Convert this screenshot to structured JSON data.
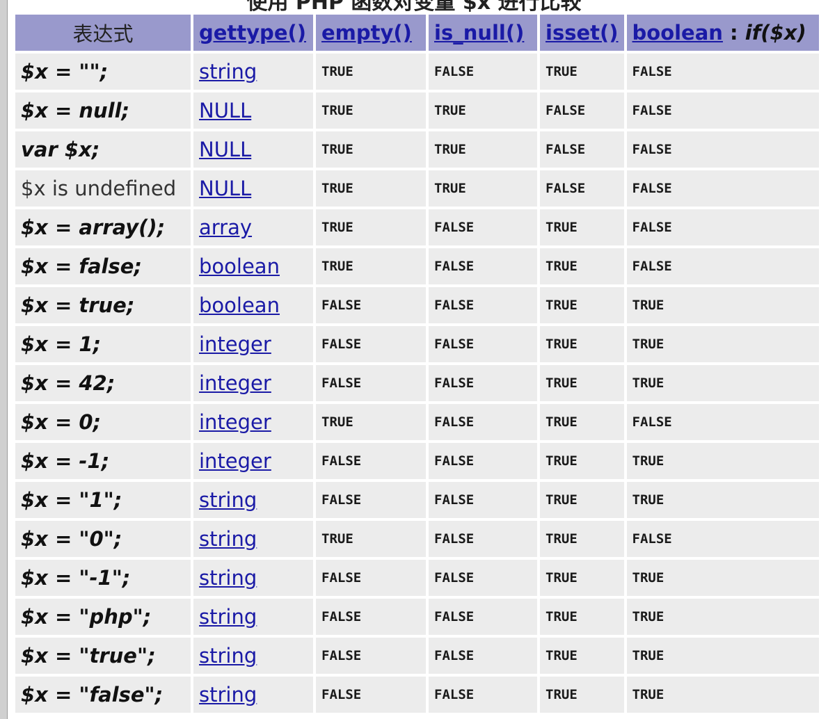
{
  "caption": "使用 PHP 函数对变量 $x 进行比较",
  "headers": {
    "expression": "表达式",
    "gettype": "gettype()",
    "empty": "empty()",
    "is_null": "is_null()",
    "isset": "isset()",
    "boolean": "boolean",
    "boolean_sep": " : ",
    "boolean_if": "if($x)"
  },
  "rows": [
    {
      "expr": "$x = \"\";",
      "type": "string",
      "empty": "TRUE",
      "is_null": "FALSE",
      "isset": "TRUE",
      "boolean": "FALSE"
    },
    {
      "expr": "$x = null;",
      "type": "NULL",
      "empty": "TRUE",
      "is_null": "TRUE",
      "isset": "FALSE",
      "boolean": "FALSE"
    },
    {
      "expr": "var $x;",
      "type": "NULL",
      "empty": "TRUE",
      "is_null": "TRUE",
      "isset": "FALSE",
      "boolean": "FALSE"
    },
    {
      "expr": "$x is undefined",
      "type": "NULL",
      "empty": "TRUE",
      "is_null": "TRUE",
      "isset": "FALSE",
      "boolean": "FALSE"
    },
    {
      "expr": "$x = array();",
      "type": "array",
      "empty": "TRUE",
      "is_null": "FALSE",
      "isset": "TRUE",
      "boolean": "FALSE"
    },
    {
      "expr": "$x = false;",
      "type": "boolean",
      "empty": "TRUE",
      "is_null": "FALSE",
      "isset": "TRUE",
      "boolean": "FALSE"
    },
    {
      "expr": "$x = true;",
      "type": "boolean",
      "empty": "FALSE",
      "is_null": "FALSE",
      "isset": "TRUE",
      "boolean": "TRUE"
    },
    {
      "expr": "$x = 1;",
      "type": "integer",
      "empty": "FALSE",
      "is_null": "FALSE",
      "isset": "TRUE",
      "boolean": "TRUE"
    },
    {
      "expr": "$x = 42;",
      "type": "integer",
      "empty": "FALSE",
      "is_null": "FALSE",
      "isset": "TRUE",
      "boolean": "TRUE"
    },
    {
      "expr": "$x = 0;",
      "type": "integer",
      "empty": "TRUE",
      "is_null": "FALSE",
      "isset": "TRUE",
      "boolean": "FALSE"
    },
    {
      "expr": "$x = -1;",
      "type": "integer",
      "empty": "FALSE",
      "is_null": "FALSE",
      "isset": "TRUE",
      "boolean": "TRUE"
    },
    {
      "expr": "$x = \"1\";",
      "type": "string",
      "empty": "FALSE",
      "is_null": "FALSE",
      "isset": "TRUE",
      "boolean": "TRUE"
    },
    {
      "expr": "$x = \"0\";",
      "type": "string",
      "empty": "TRUE",
      "is_null": "FALSE",
      "isset": "TRUE",
      "boolean": "FALSE"
    },
    {
      "expr": "$x = \"-1\";",
      "type": "string",
      "empty": "FALSE",
      "is_null": "FALSE",
      "isset": "TRUE",
      "boolean": "TRUE"
    },
    {
      "expr": "$x = \"php\";",
      "type": "string",
      "empty": "FALSE",
      "is_null": "FALSE",
      "isset": "TRUE",
      "boolean": "TRUE"
    },
    {
      "expr": "$x = \"true\";",
      "type": "string",
      "empty": "FALSE",
      "is_null": "FALSE",
      "isset": "TRUE",
      "boolean": "TRUE"
    },
    {
      "expr": "$x = \"false\";",
      "type": "string",
      "empty": "FALSE",
      "is_null": "FALSE",
      "isset": "TRUE",
      "boolean": "TRUE"
    }
  ],
  "colors": {
    "header_bg": "#9999cc",
    "cell_bg": "#ececec",
    "link": "#1a1aa6"
  }
}
